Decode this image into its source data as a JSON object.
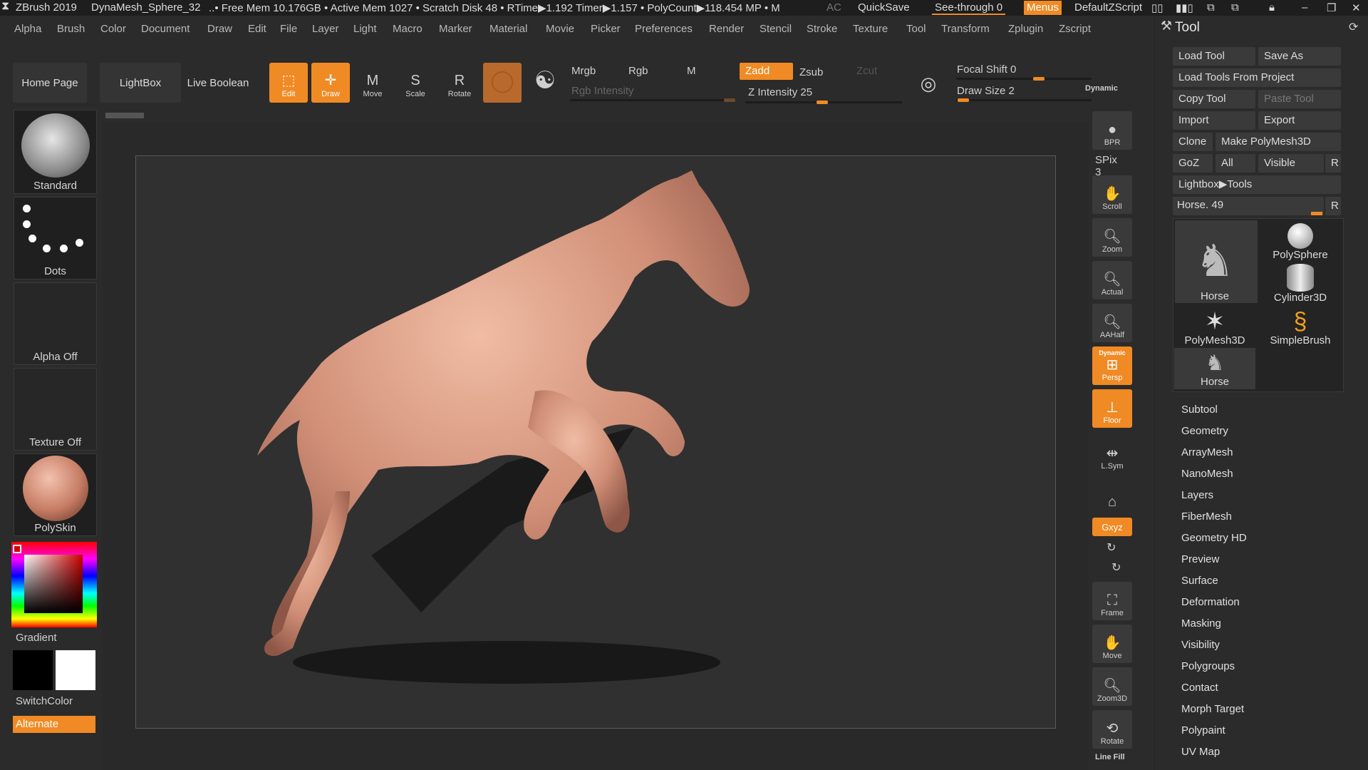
{
  "titlebar": {
    "app": "ZBrush 2019",
    "doc": "DynaMesh_Sphere_32",
    "stats": "..• Free Mem 10.176GB • Active Mem 1027 • Scratch Disk 48 •  RTime▶1.192 Timer▶1.157 • PolyCount▶118.454 MP  • M",
    "ac": "AC",
    "quicksave": "QuickSave",
    "seethrough": "See-through  0",
    "menus": "Menus",
    "script": "DefaultZScript"
  },
  "menubar": [
    "Alpha",
    "Brush",
    "Color",
    "Document",
    "Draw",
    "Edit",
    "File",
    "Layer",
    "Light",
    "Macro",
    "Marker",
    "Material",
    "Movie",
    "Picker",
    "Preferences",
    "Render",
    "Stencil",
    "Stroke",
    "Texture",
    "Tool",
    "Transform",
    "Zplugin",
    "Zscript"
  ],
  "toolbar": {
    "home": "Home Page",
    "lightbox": "LightBox",
    "liveboolean": "Live Boolean",
    "edit": "Edit",
    "draw": "Draw",
    "move": "Move",
    "scale": "Scale",
    "rotate": "Rotate",
    "mrgb": "Mrgb",
    "rgb": "Rgb",
    "m": "M",
    "rgb_intensity": "Rgb Intensity",
    "zadd": "Zadd",
    "zsub": "Zsub",
    "zcut": "Zcut",
    "z_intensity": "Z Intensity 25",
    "focal_shift": "Focal Shift 0",
    "draw_size": "Draw Size 2",
    "dynamic": "Dynamic",
    "z_intensity_value": 25,
    "draw_size_value": 2
  },
  "leftshelf": {
    "brush": "Standard",
    "stroke": "Dots",
    "alpha": "Alpha Off",
    "texture": "Texture Off",
    "material": "PolySkin",
    "gradient": "Gradient",
    "switchcolor": "SwitchColor",
    "alternate": "Alternate"
  },
  "rightshelf": {
    "bpr": "BPR",
    "spix": "SPix 3",
    "scroll": "Scroll",
    "zoom": "Zoom",
    "actual": "Actual",
    "aahalf": "AAHalf",
    "persp": "Persp",
    "persp_top": "Dynamic",
    "floor": "Floor",
    "lsym": "L.Sym",
    "xyz": "Gxyz",
    "frame": "Frame",
    "move": "Move",
    "zoom3d": "Zoom3D",
    "rotate": "Rotate",
    "linefill": "Line Fill"
  },
  "toolpanel": {
    "title": "Tool",
    "load_tool": "Load Tool",
    "save_as": "Save As",
    "load_from_project": "Load Tools From Project",
    "copy_tool": "Copy Tool",
    "paste_tool": "Paste Tool",
    "import": "Import",
    "export": "Export",
    "clone": "Clone",
    "make_polymesh": "Make PolyMesh3D",
    "goz": "GoZ",
    "all": "All",
    "visible": "Visible",
    "r": "R",
    "lightbox_tools": "Lightbox▶Tools",
    "current_tool": "Horse. 49",
    "thumbs": [
      "Horse",
      "PolySphere",
      "Cylinder3D",
      "PolyMesh3D",
      "SimpleBrush",
      "Horse"
    ],
    "sections": [
      "Subtool",
      "Geometry",
      "ArrayMesh",
      "NanoMesh",
      "Layers",
      "FiberMesh",
      "Geometry HD",
      "Preview",
      "Surface",
      "Deformation",
      "Masking",
      "Visibility",
      "Polygroups",
      "Contact",
      "Morph Target",
      "Polypaint",
      "UV Map"
    ]
  },
  "colors": {
    "accent": "#f08a24",
    "bg": "#2b2b2b",
    "canvas": "#303030",
    "skin": "#d9a08a"
  }
}
